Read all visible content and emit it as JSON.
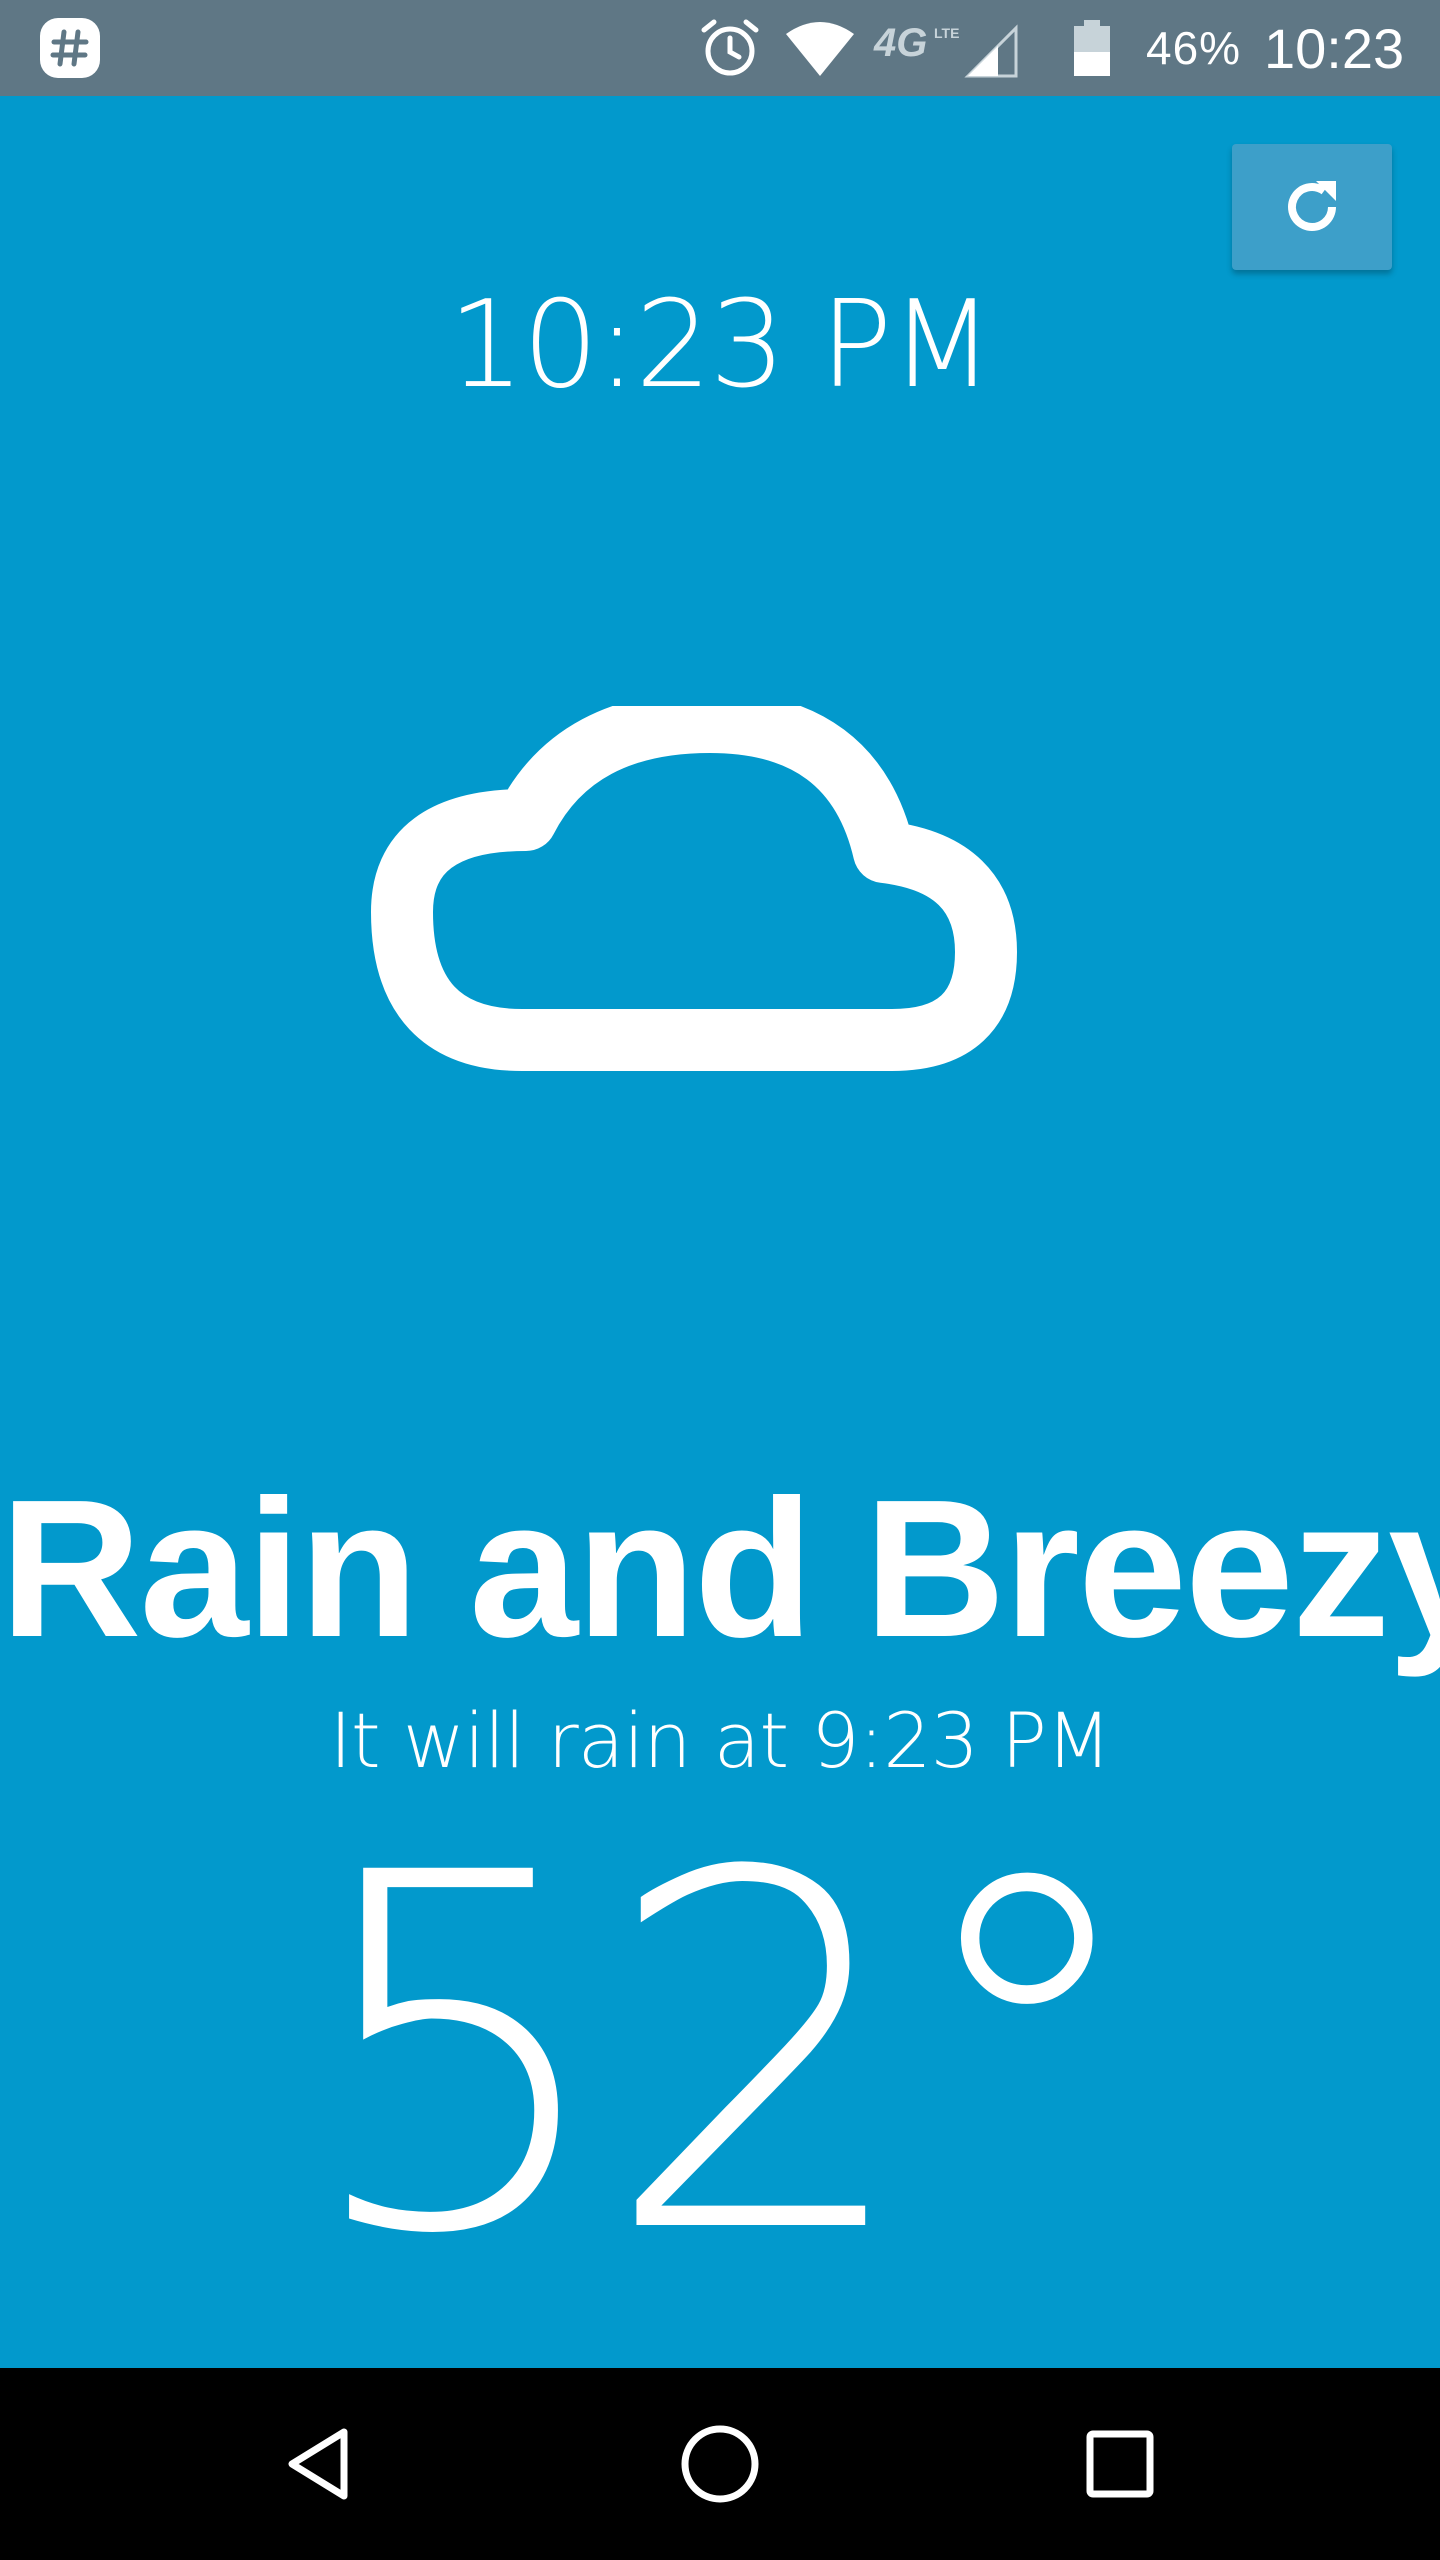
{
  "status_bar": {
    "battery_percent": "46%",
    "clock": "10:23",
    "network_type": "4G LTE",
    "background_color": "#5f7785"
  },
  "toolbar": {
    "refresh_icon": "refresh-icon",
    "refresh_button_color": "#3d9fc9"
  },
  "weather": {
    "time": "10:23 PM",
    "icon": "cloud-icon",
    "summary": "Rain and Breezy",
    "forecast": "It will rain at 9:23 PM",
    "temperature": "52°",
    "background_color": "#0299cc"
  },
  "nav_bar": {
    "back_icon": "back-triangle-icon",
    "home_icon": "home-circle-icon",
    "recents_icon": "recents-square-icon"
  }
}
